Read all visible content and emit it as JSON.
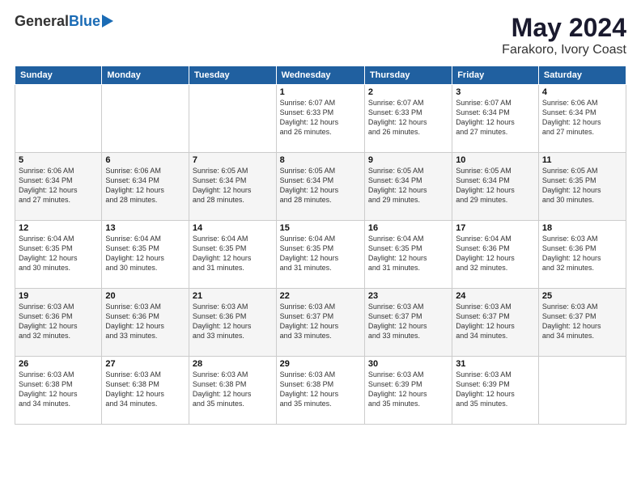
{
  "header": {
    "logo_general": "General",
    "logo_blue": "Blue",
    "title": "May 2024",
    "subtitle": "Farakoro, Ivory Coast"
  },
  "calendar": {
    "days_of_week": [
      "Sunday",
      "Monday",
      "Tuesday",
      "Wednesday",
      "Thursday",
      "Friday",
      "Saturday"
    ],
    "weeks": [
      [
        {
          "day": "",
          "info": ""
        },
        {
          "day": "",
          "info": ""
        },
        {
          "day": "",
          "info": ""
        },
        {
          "day": "1",
          "info": "Sunrise: 6:07 AM\nSunset: 6:33 PM\nDaylight: 12 hours\nand 26 minutes."
        },
        {
          "day": "2",
          "info": "Sunrise: 6:07 AM\nSunset: 6:33 PM\nDaylight: 12 hours\nand 26 minutes."
        },
        {
          "day": "3",
          "info": "Sunrise: 6:07 AM\nSunset: 6:34 PM\nDaylight: 12 hours\nand 27 minutes."
        },
        {
          "day": "4",
          "info": "Sunrise: 6:06 AM\nSunset: 6:34 PM\nDaylight: 12 hours\nand 27 minutes."
        }
      ],
      [
        {
          "day": "5",
          "info": "Sunrise: 6:06 AM\nSunset: 6:34 PM\nDaylight: 12 hours\nand 27 minutes."
        },
        {
          "day": "6",
          "info": "Sunrise: 6:06 AM\nSunset: 6:34 PM\nDaylight: 12 hours\nand 28 minutes."
        },
        {
          "day": "7",
          "info": "Sunrise: 6:05 AM\nSunset: 6:34 PM\nDaylight: 12 hours\nand 28 minutes."
        },
        {
          "day": "8",
          "info": "Sunrise: 6:05 AM\nSunset: 6:34 PM\nDaylight: 12 hours\nand 28 minutes."
        },
        {
          "day": "9",
          "info": "Sunrise: 6:05 AM\nSunset: 6:34 PM\nDaylight: 12 hours\nand 29 minutes."
        },
        {
          "day": "10",
          "info": "Sunrise: 6:05 AM\nSunset: 6:34 PM\nDaylight: 12 hours\nand 29 minutes."
        },
        {
          "day": "11",
          "info": "Sunrise: 6:05 AM\nSunset: 6:35 PM\nDaylight: 12 hours\nand 30 minutes."
        }
      ],
      [
        {
          "day": "12",
          "info": "Sunrise: 6:04 AM\nSunset: 6:35 PM\nDaylight: 12 hours\nand 30 minutes."
        },
        {
          "day": "13",
          "info": "Sunrise: 6:04 AM\nSunset: 6:35 PM\nDaylight: 12 hours\nand 30 minutes."
        },
        {
          "day": "14",
          "info": "Sunrise: 6:04 AM\nSunset: 6:35 PM\nDaylight: 12 hours\nand 31 minutes."
        },
        {
          "day": "15",
          "info": "Sunrise: 6:04 AM\nSunset: 6:35 PM\nDaylight: 12 hours\nand 31 minutes."
        },
        {
          "day": "16",
          "info": "Sunrise: 6:04 AM\nSunset: 6:35 PM\nDaylight: 12 hours\nand 31 minutes."
        },
        {
          "day": "17",
          "info": "Sunrise: 6:04 AM\nSunset: 6:36 PM\nDaylight: 12 hours\nand 32 minutes."
        },
        {
          "day": "18",
          "info": "Sunrise: 6:03 AM\nSunset: 6:36 PM\nDaylight: 12 hours\nand 32 minutes."
        }
      ],
      [
        {
          "day": "19",
          "info": "Sunrise: 6:03 AM\nSunset: 6:36 PM\nDaylight: 12 hours\nand 32 minutes."
        },
        {
          "day": "20",
          "info": "Sunrise: 6:03 AM\nSunset: 6:36 PM\nDaylight: 12 hours\nand 33 minutes."
        },
        {
          "day": "21",
          "info": "Sunrise: 6:03 AM\nSunset: 6:36 PM\nDaylight: 12 hours\nand 33 minutes."
        },
        {
          "day": "22",
          "info": "Sunrise: 6:03 AM\nSunset: 6:37 PM\nDaylight: 12 hours\nand 33 minutes."
        },
        {
          "day": "23",
          "info": "Sunrise: 6:03 AM\nSunset: 6:37 PM\nDaylight: 12 hours\nand 33 minutes."
        },
        {
          "day": "24",
          "info": "Sunrise: 6:03 AM\nSunset: 6:37 PM\nDaylight: 12 hours\nand 34 minutes."
        },
        {
          "day": "25",
          "info": "Sunrise: 6:03 AM\nSunset: 6:37 PM\nDaylight: 12 hours\nand 34 minutes."
        }
      ],
      [
        {
          "day": "26",
          "info": "Sunrise: 6:03 AM\nSunset: 6:38 PM\nDaylight: 12 hours\nand 34 minutes."
        },
        {
          "day": "27",
          "info": "Sunrise: 6:03 AM\nSunset: 6:38 PM\nDaylight: 12 hours\nand 34 minutes."
        },
        {
          "day": "28",
          "info": "Sunrise: 6:03 AM\nSunset: 6:38 PM\nDaylight: 12 hours\nand 35 minutes."
        },
        {
          "day": "29",
          "info": "Sunrise: 6:03 AM\nSunset: 6:38 PM\nDaylight: 12 hours\nand 35 minutes."
        },
        {
          "day": "30",
          "info": "Sunrise: 6:03 AM\nSunset: 6:39 PM\nDaylight: 12 hours\nand 35 minutes."
        },
        {
          "day": "31",
          "info": "Sunrise: 6:03 AM\nSunset: 6:39 PM\nDaylight: 12 hours\nand 35 minutes."
        },
        {
          "day": "",
          "info": ""
        }
      ]
    ]
  }
}
